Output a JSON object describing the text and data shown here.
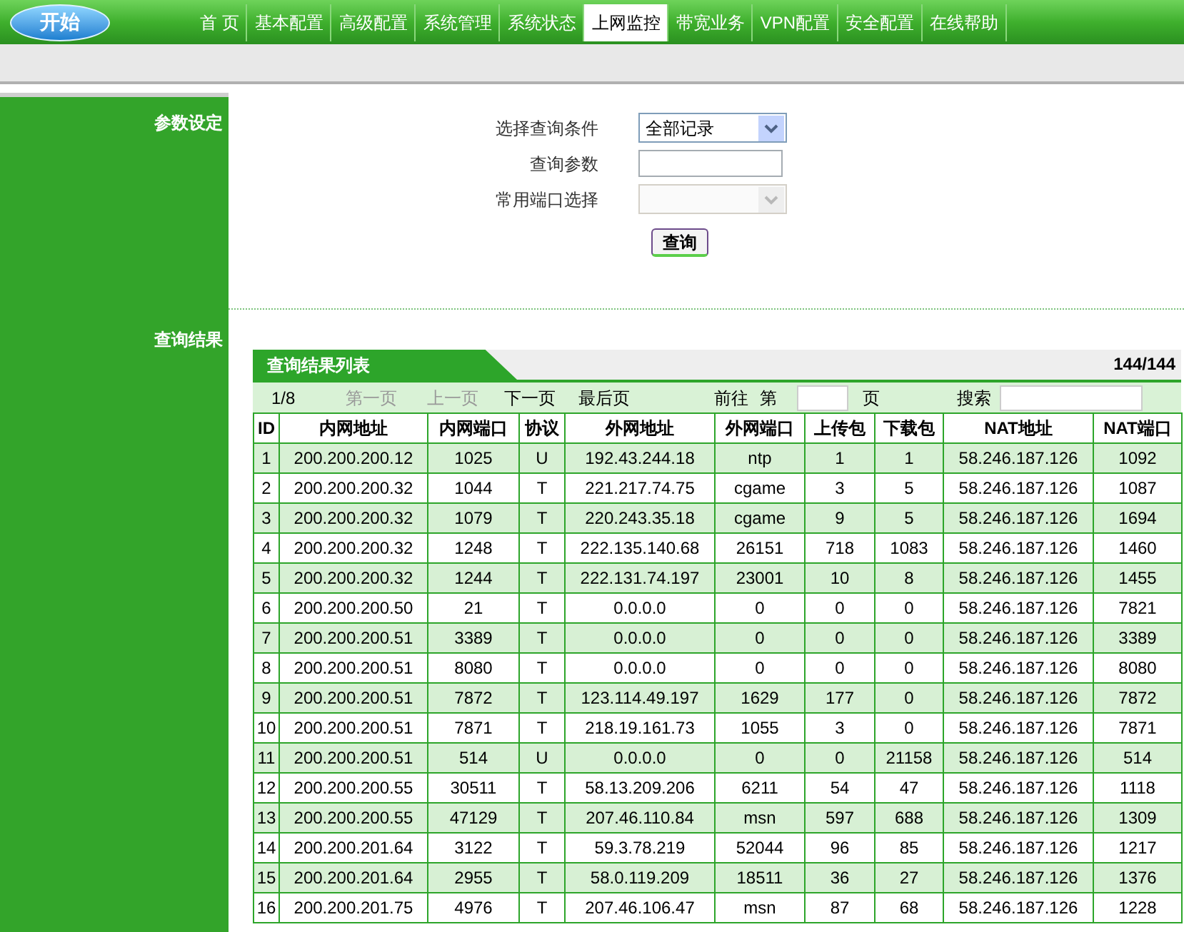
{
  "logo": {
    "label": "开始"
  },
  "tabs": [
    {
      "label": "首 页",
      "selected": false
    },
    {
      "label": "基本配置",
      "selected": false
    },
    {
      "label": "高级配置",
      "selected": false
    },
    {
      "label": "系统管理",
      "selected": false
    },
    {
      "label": "系统状态",
      "selected": false
    },
    {
      "label": "上网监控",
      "selected": true
    },
    {
      "label": "带宽业务",
      "selected": false
    },
    {
      "label": "VPN配置",
      "selected": false
    },
    {
      "label": "安全配置",
      "selected": false
    },
    {
      "label": "在线帮助",
      "selected": false
    }
  ],
  "sections": [
    {
      "label": "参数设定"
    },
    {
      "label": "查询结果"
    }
  ],
  "form": {
    "fields": [
      {
        "kind": "select",
        "label": "选择查询条件",
        "value": "全部记录",
        "disabled": false
      },
      {
        "kind": "input",
        "label": "查询参数",
        "disabled": false
      },
      {
        "kind": "select",
        "label": "常用端口选择",
        "disabled": true
      }
    ],
    "submit": "查询"
  },
  "results": {
    "title": "查询结果列表",
    "count": "144/144",
    "pager": {
      "page": "1/8",
      "first": {
        "label": "第一页",
        "disabled": true
      },
      "prev": {
        "label": "上一页",
        "disabled": true
      },
      "next": {
        "label": "下一页",
        "disabled": false
      },
      "last": {
        "label": "最后页",
        "disabled": false
      },
      "goto_prefix": "前往",
      "goto_di": "第",
      "goto_suffix": "页",
      "search": "搜索"
    },
    "table": {
      "columns": [
        "ID",
        "内网地址",
        "内网端口",
        "协议",
        "外网地址",
        "外网端口",
        "上传包",
        "下载包",
        "NAT地址",
        "NAT端口"
      ],
      "rows": [
        [
          "1",
          "200.200.200.12",
          "1025",
          "U",
          "192.43.244.18",
          "ntp",
          "1",
          "1",
          "58.246.187.126",
          "1092"
        ],
        [
          "2",
          "200.200.200.32",
          "1044",
          "T",
          "221.217.74.75",
          "cgame",
          "3",
          "5",
          "58.246.187.126",
          "1087"
        ],
        [
          "3",
          "200.200.200.32",
          "1079",
          "T",
          "220.243.35.18",
          "cgame",
          "9",
          "5",
          "58.246.187.126",
          "1694"
        ],
        [
          "4",
          "200.200.200.32",
          "1248",
          "T",
          "222.135.140.68",
          "26151",
          "718",
          "1083",
          "58.246.187.126",
          "1460"
        ],
        [
          "5",
          "200.200.200.32",
          "1244",
          "T",
          "222.131.74.197",
          "23001",
          "10",
          "8",
          "58.246.187.126",
          "1455"
        ],
        [
          "6",
          "200.200.200.50",
          "21",
          "T",
          "0.0.0.0",
          "0",
          "0",
          "0",
          "58.246.187.126",
          "7821"
        ],
        [
          "7",
          "200.200.200.51",
          "3389",
          "T",
          "0.0.0.0",
          "0",
          "0",
          "0",
          "58.246.187.126",
          "3389"
        ],
        [
          "8",
          "200.200.200.51",
          "8080",
          "T",
          "0.0.0.0",
          "0",
          "0",
          "0",
          "58.246.187.126",
          "8080"
        ],
        [
          "9",
          "200.200.200.51",
          "7872",
          "T",
          "123.114.49.197",
          "1629",
          "177",
          "0",
          "58.246.187.126",
          "7872"
        ],
        [
          "10",
          "200.200.200.51",
          "7871",
          "T",
          "218.19.161.73",
          "1055",
          "3",
          "0",
          "58.246.187.126",
          "7871"
        ],
        [
          "11",
          "200.200.200.51",
          "514",
          "U",
          "0.0.0.0",
          "0",
          "0",
          "21158",
          "58.246.187.126",
          "514"
        ],
        [
          "12",
          "200.200.200.55",
          "30511",
          "T",
          "58.13.209.206",
          "6211",
          "54",
          "47",
          "58.246.187.126",
          "1118"
        ],
        [
          "13",
          "200.200.200.55",
          "47129",
          "T",
          "207.46.110.84",
          "msn",
          "597",
          "688",
          "58.246.187.126",
          "1309"
        ],
        [
          "14",
          "200.200.201.64",
          "3122",
          "T",
          "59.3.78.219",
          "52044",
          "96",
          "85",
          "58.246.187.126",
          "1217"
        ],
        [
          "15",
          "200.200.201.64",
          "2955",
          "T",
          "58.0.119.209",
          "18511",
          "36",
          "27",
          "58.246.187.126",
          "1376"
        ],
        [
          "16",
          "200.200.201.75",
          "4976",
          "T",
          "207.46.106.47",
          "msn",
          "87",
          "68",
          "58.246.187.126",
          "1228"
        ]
      ]
    }
  }
}
